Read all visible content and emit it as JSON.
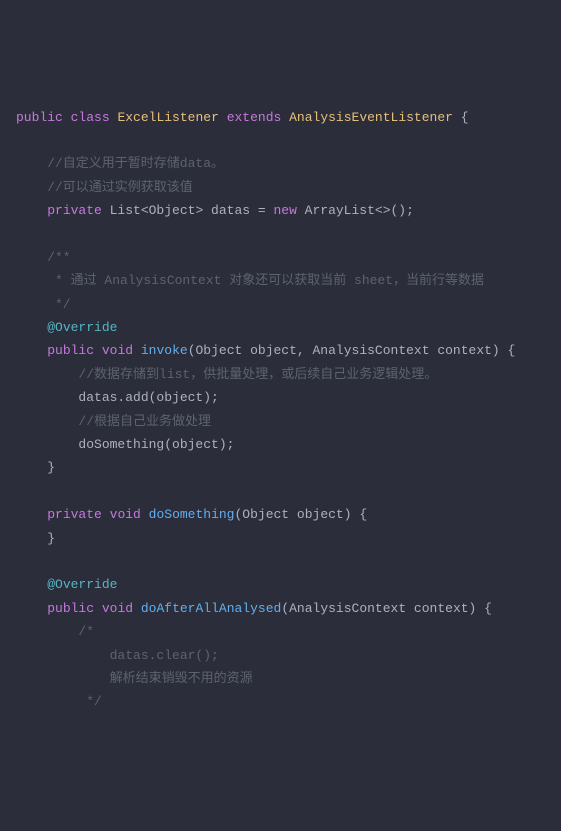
{
  "code": {
    "line1": {
      "kw_public": "public",
      "kw_class": "class",
      "classname1": "ExcelListener",
      "kw_extends": "extends",
      "classname2": "AnalysisEventListener",
      "brace": " {"
    },
    "line3": "    //自定义用于暂时存储data。",
    "line4": "    //可以通过实例获取该值",
    "line5": {
      "indent": "    ",
      "kw_private": "private",
      "type": " List<Object> ",
      "var": "datas",
      "eq": " = ",
      "kw_new": "new",
      "ctor": " ArrayList<>();"
    },
    "line7": "    /**",
    "line8": "     * 通过 AnalysisContext 对象还可以获取当前 sheet，当前行等数据",
    "line9": "     */",
    "line10": {
      "indent": "    ",
      "annotation": "@Override"
    },
    "line11": {
      "indent": "    ",
      "kw_public": "public",
      "sp1": " ",
      "kw_void": "void",
      "sp2": " ",
      "method": "invoke",
      "params": "(Object object, AnalysisContext context) {"
    },
    "line12": "        //数据存储到list，供批量处理，或后续自己业务逻辑处理。",
    "line13": "        datas.add(object);",
    "line14": "        //根据自己业务做处理",
    "line15": "        doSomething(object);",
    "line16": "    }",
    "line18": {
      "indent": "    ",
      "kw_private": "private",
      "sp1": " ",
      "kw_void": "void",
      "sp2": " ",
      "method": "doSomething",
      "params": "(Object object) {"
    },
    "line19": "    }",
    "line21": {
      "indent": "    ",
      "annotation": "@Override"
    },
    "line22": {
      "indent": "    ",
      "kw_public": "public",
      "sp1": " ",
      "kw_void": "void",
      "sp2": " ",
      "method": "doAfterAllAnalysed",
      "params": "(AnalysisContext context) {"
    },
    "line23": "        /*",
    "line24": "            datas.clear();",
    "line25": "            解析结束销毁不用的资源",
    "line26": "         */"
  }
}
